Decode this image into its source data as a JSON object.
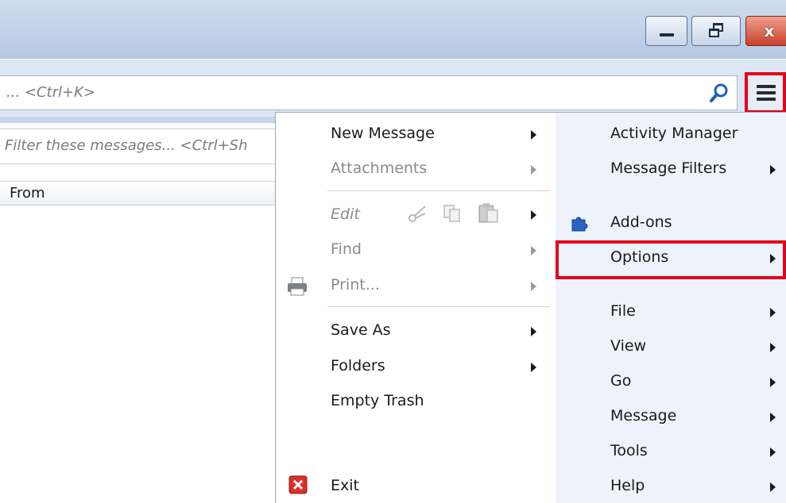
{
  "window": {
    "controls": {
      "minimize": "minimize-icon",
      "restore": "restore-icon",
      "close": "close-icon",
      "close_glyph": "x"
    }
  },
  "search": {
    "placeholder": "... <Ctrl+K>",
    "icon": "search-icon"
  },
  "app_menu_button": {
    "icon": "hamburger-menu-icon",
    "highlight_color": "#e3001b"
  },
  "filter": {
    "placeholder": "Filter these messages... <Ctrl+Sh"
  },
  "message_list": {
    "columns": [
      "From"
    ]
  },
  "app_menu": {
    "left": {
      "new_message": "New Message",
      "attachments": "Attachments",
      "edit": "Edit",
      "edit_icons": [
        "cut-icon",
        "copy-icon",
        "paste-icon"
      ],
      "find": "Find",
      "print": "Print...",
      "print_icon": "printer-icon",
      "save_as": "Save As",
      "folders": "Folders",
      "empty_trash": "Empty Trash",
      "exit": "Exit",
      "exit_icon": "exit-icon"
    },
    "right": {
      "activity_manager": "Activity Manager",
      "message_filters": "Message Filters",
      "addons": "Add-ons",
      "addons_icon": "puzzle-piece-icon",
      "options": "Options",
      "file": "File",
      "view": "View",
      "go": "Go",
      "message": "Message",
      "tools": "Tools",
      "help": "Help"
    }
  },
  "colors": {
    "highlight": "#e3001b",
    "menu_right_bg": "#eef3fb",
    "titlebar": "#c4d4ea",
    "disabled_text": "#8a8a8a"
  }
}
